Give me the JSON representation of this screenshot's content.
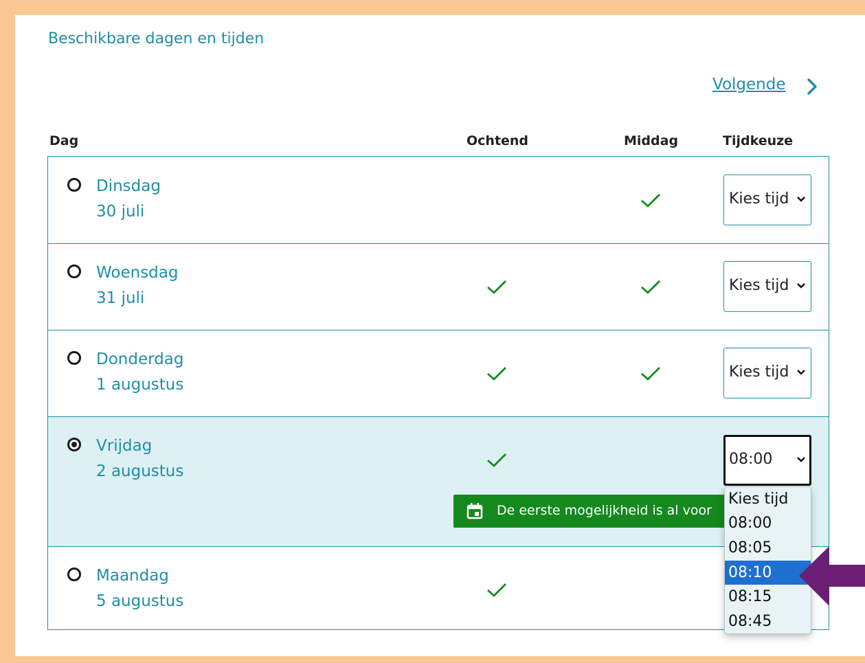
{
  "header": {
    "title": "Beschikbare dagen en tijden",
    "next_label": "Volgende"
  },
  "columns": {
    "day": "Dag",
    "morning": "Ochtend",
    "afternoon": "Middag",
    "time": "Tijdkeuze"
  },
  "days": [
    {
      "name": "Dinsdag",
      "date": "30 juli",
      "morning": false,
      "afternoon": true,
      "selected": false,
      "time_value": "Kies tijd"
    },
    {
      "name": "Woensdag",
      "date": "31 juli",
      "morning": true,
      "afternoon": true,
      "selected": false,
      "time_value": "Kies tijd"
    },
    {
      "name": "Donderdag",
      "date": "1 augustus",
      "morning": true,
      "afternoon": true,
      "selected": false,
      "time_value": "Kies tijd"
    },
    {
      "name": "Vrijdag",
      "date": "2 augustus",
      "morning": true,
      "afternoon": false,
      "selected": true,
      "time_value": "08:00"
    },
    {
      "name": "Maandag",
      "date": "5 augustus",
      "morning": true,
      "afternoon": false,
      "selected": false,
      "time_value": ""
    }
  ],
  "notice": {
    "text": "De eerste mogelijkheid is al voor",
    "icon": "calendar-icon"
  },
  "dropdown": {
    "options": [
      "Kies tijd",
      "08:00",
      "08:05",
      "08:10",
      "08:15",
      "08:45"
    ],
    "highlighted": "08:10"
  },
  "colors": {
    "accent": "#1f8fa5",
    "check": "#14891e",
    "selected_row_bg": "#ddf0f4",
    "highlight": "#1d6fd0",
    "arrow": "#6b1f74",
    "frame": "#f7c892"
  }
}
